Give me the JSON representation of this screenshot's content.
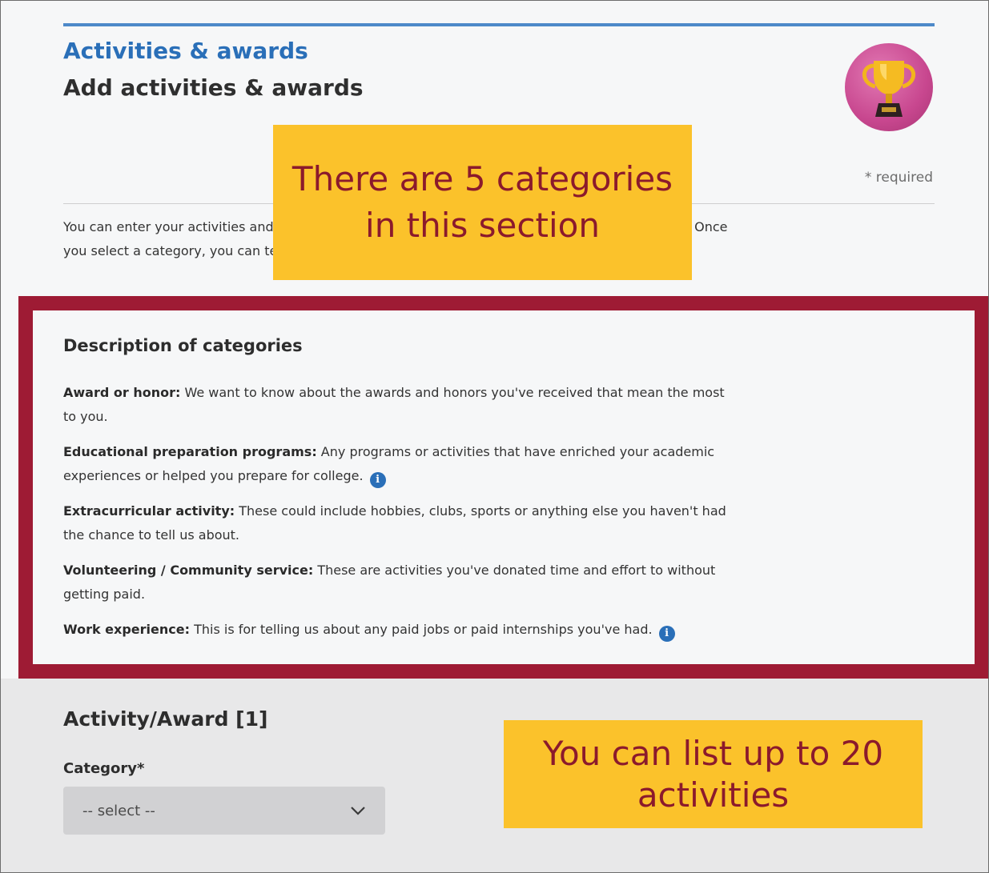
{
  "header": {
    "section_title": "Activities & awards",
    "page_heading": "Add activities & awards",
    "required_note": "* required",
    "trophy_icon": "trophy-icon"
  },
  "intro": {
    "text": "You can enter your activities and awards by selecting a category from the dropdown menu below. Once you select a category, you can tell us about the activity or award in the follow-up questions."
  },
  "callouts": {
    "categories": "There are 5 categories in this section",
    "limit": "You can list up to 20 activities"
  },
  "categories": {
    "title": "Description of categories",
    "items": [
      {
        "term": "Award or honor:",
        "description": " We want to know about the awards and honors you've received that mean the most to you.",
        "info": false
      },
      {
        "term": "Educational preparation programs:",
        "description": " Any programs or activities that have enriched your academic experiences or helped you prepare for college.",
        "info": true
      },
      {
        "term": "Extracurricular activity:",
        "description": " These could include hobbies, clubs, sports or anything else you haven't had the chance to tell us about.",
        "info": false
      },
      {
        "term": "Volunteering / Community service:",
        "description": " These are activities you've donated time and effort to without getting paid.",
        "info": false
      },
      {
        "term": "Work experience:",
        "description": " This is for telling us about any paid jobs or paid internships you've had.",
        "info": true
      }
    ],
    "info_glyph": "i"
  },
  "activity": {
    "title": "Activity/Award [1]",
    "category_label": "Category*",
    "category_value": "-- select --"
  },
  "colors": {
    "accent_blue": "#2a6fb8",
    "highlight_border": "#9e1b34",
    "callout_bg": "#fbc22b",
    "callout_text": "#8b1a2c"
  }
}
